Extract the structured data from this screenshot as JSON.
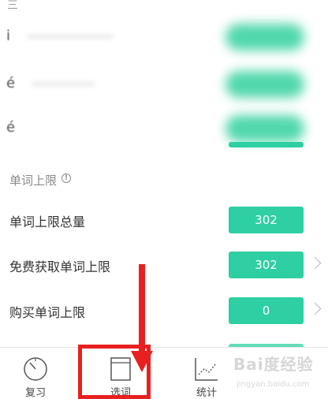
{
  "section": {
    "title": "单词上限",
    "info_icon": "info-icon"
  },
  "rows": [
    {
      "label": "单词上限总量",
      "value": "302",
      "has_chevron": false
    },
    {
      "label": "免费获取单词上限",
      "value": "302",
      "has_chevron": true
    },
    {
      "label": "购买单词上限",
      "value": "0",
      "has_chevron": true
    }
  ],
  "tabbar": {
    "tabs": [
      {
        "label": "复习",
        "icon": "review-dial-icon"
      },
      {
        "label": "选词",
        "icon": "book-icon"
      },
      {
        "label": "统计",
        "icon": "chart-line-icon"
      }
    ]
  },
  "watermark": {
    "text": "Bai度经验",
    "sub": "jingyan.baidu.com"
  },
  "colors": {
    "accent": "#2ecfa2",
    "annotation_red": "#e82020"
  }
}
